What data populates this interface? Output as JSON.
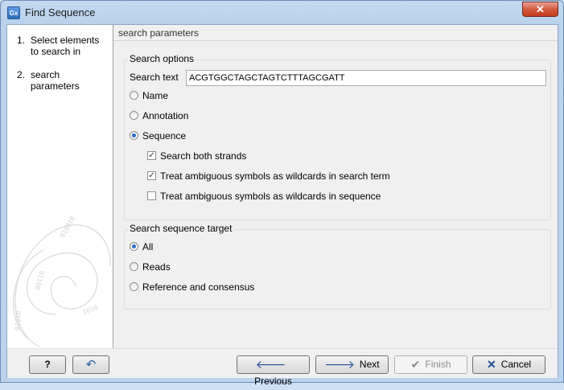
{
  "window": {
    "title": "Find Sequence",
    "icon_text": "Gx",
    "close_glyph": "✕"
  },
  "steps": [
    {
      "num": "1.",
      "label": "Select elements to search in"
    },
    {
      "num": "2.",
      "label": "search parameters"
    }
  ],
  "content": {
    "section_title": "search parameters",
    "search_options": {
      "title": "Search options",
      "search_text_label": "Search text",
      "search_text_value": "ACGTGGCTAGCTAGTCTTTAGCGATT",
      "types": [
        {
          "label": "Name",
          "selected": false
        },
        {
          "label": "Annotation",
          "selected": false
        },
        {
          "label": "Sequence",
          "selected": true
        }
      ],
      "options": [
        {
          "label": "Search both strands",
          "checked": true
        },
        {
          "label": "Treat ambiguous symbols as wildcards in search term",
          "checked": true
        },
        {
          "label": "Treat ambiguous symbols as wildcards in sequence",
          "checked": false
        }
      ]
    },
    "target": {
      "title": "Search sequence target",
      "choices": [
        {
          "label": "All",
          "selected": true
        },
        {
          "label": "Reads",
          "selected": false
        },
        {
          "label": "Reference and consensus",
          "selected": false
        }
      ]
    }
  },
  "footer": {
    "help": "?",
    "reset_glyph": "↶",
    "previous": "Previous",
    "next": "Next",
    "finish": "Finish",
    "cancel": "Cancel",
    "previous_glyph": "🡐",
    "next_glyph": "🡒",
    "finish_glyph": "✔",
    "cancel_glyph": "✕"
  },
  "colors": {
    "accent": "#2b6fc7",
    "title_bar": "#c4d9f1",
    "close": "#c33c1f"
  }
}
